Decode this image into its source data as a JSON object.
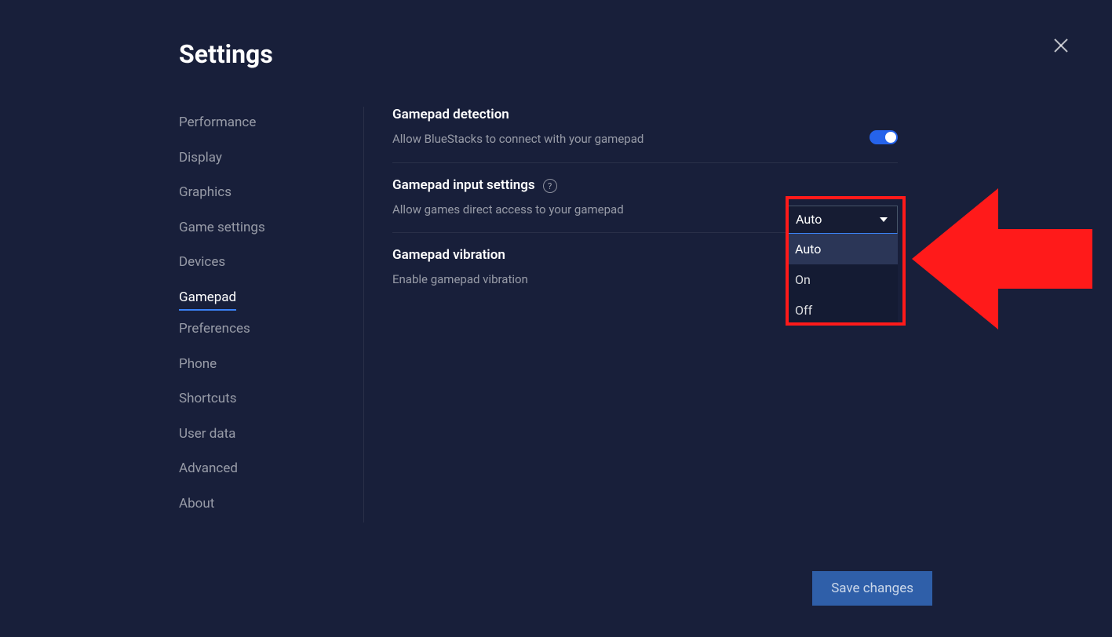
{
  "title": "Settings",
  "sidebar": {
    "items": [
      {
        "label": "Performance"
      },
      {
        "label": "Display"
      },
      {
        "label": "Graphics"
      },
      {
        "label": "Game settings"
      },
      {
        "label": "Devices"
      },
      {
        "label": "Gamepad"
      },
      {
        "label": "Preferences"
      },
      {
        "label": "Phone"
      },
      {
        "label": "Shortcuts"
      },
      {
        "label": "User data"
      },
      {
        "label": "Advanced"
      },
      {
        "label": "About"
      }
    ],
    "active": "Gamepad"
  },
  "sections": {
    "detection": {
      "title": "Gamepad detection",
      "desc": "Allow BlueStacks to connect with your gamepad"
    },
    "input": {
      "title": "Gamepad input settings",
      "desc": "Allow games direct access to your gamepad",
      "selected": "Auto",
      "options": [
        "Auto",
        "On",
        "Off"
      ]
    },
    "vibration": {
      "title": "Gamepad vibration",
      "desc": "Enable gamepad vibration"
    }
  },
  "help_icon_char": "?",
  "save_label": "Save changes"
}
